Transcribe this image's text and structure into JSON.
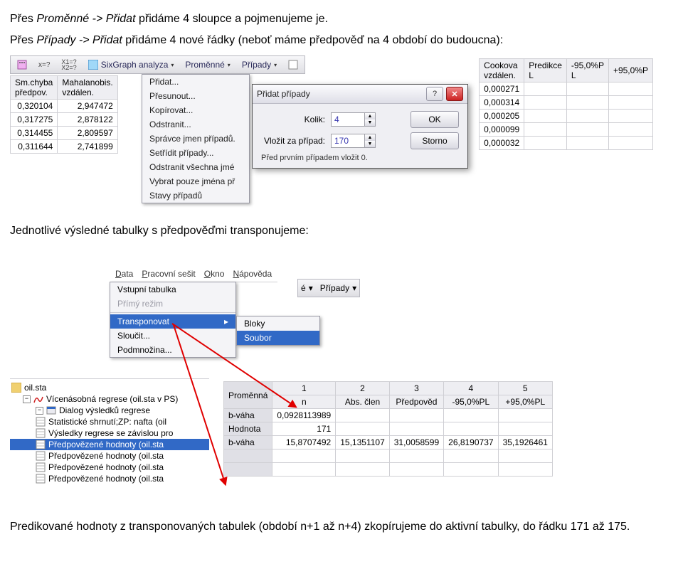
{
  "text": {
    "intro1_a": "Přes ",
    "intro1_em": "Proměnné -> Přidat",
    "intro1_b": " přidáme 4 sloupce a pojmenujeme je.",
    "intro2_a": "Přes ",
    "intro2_em": "Případy -> Přidat",
    "intro2_b": " přidáme 4 nové řádky (neboť máme předpověď na 4 období do budoucna):",
    "mid": "Jednotlivé výsledné tabulky s předpověďmi transponujeme:",
    "outro": "Predikované hodnoty z transponovaných tabulek (období n+1 až n+4) zkopírujeme do aktivní tabulky, do řádku 171 až 175."
  },
  "toolbar1": {
    "sixgraph": "SixGraph  analyza",
    "promenne": "Proměnné",
    "pripady": "Případy"
  },
  "ctx": {
    "items": [
      "Přidat...",
      "Přesunout...",
      "Kopírovat...",
      "Odstranit...",
      "Správce jmen případů.",
      "Setřídit případy...",
      "Odstranit všechna jmé",
      "Vybrat pouze jména př",
      "Stavy případů"
    ]
  },
  "dlg": {
    "title": "Přidat případy",
    "kolik": "Kolik:",
    "kolik_val": "4",
    "vlozit": "Vložit za případ:",
    "vlozit_val": "170",
    "ok": "OK",
    "storno": "Storno",
    "foot": "Před prvním případem vložit 0."
  },
  "lefttable": {
    "h1a": "Sm.chyba",
    "h1b": "předpov.",
    "h2a": "Mahalanobis.",
    "h2b": "vzdálen.",
    "rows": [
      [
        "0,320104",
        "2,947472"
      ],
      [
        "0,317275",
        "2,878122"
      ],
      [
        "0,314455",
        "2,809597"
      ],
      [
        "0,311644",
        "2,741899"
      ]
    ]
  },
  "righttable": {
    "h1a": "Cookova",
    "h1b": "vzdálen.",
    "h2a": "Predikce",
    "h2b": "L",
    "h3a": "-95,0%P",
    "h3b": "L",
    "h4a": "+95,0%P",
    "h4b": "",
    "rows": [
      [
        "0,000271",
        "",
        "",
        ""
      ],
      [
        "0,000314",
        "",
        "",
        ""
      ],
      [
        "0,000205",
        "",
        "",
        ""
      ],
      [
        "0,000099",
        "",
        "",
        ""
      ],
      [
        "0,000032",
        "",
        "",
        ""
      ]
    ]
  },
  "menubar": {
    "items": [
      "Data",
      "Pracovní sešit",
      "Okno",
      "Nápověda"
    ],
    "u": [
      "D",
      "P",
      "O",
      "N"
    ]
  },
  "datapanel": {
    "items": [
      "Vstupní tabulka",
      "Přímý režim",
      "Transponovat",
      "Sloučit...",
      "Podmnožina..."
    ],
    "selected_index": 2
  },
  "submenu": {
    "items": [
      "Bloky",
      "Soubor"
    ],
    "selected_index": 1
  },
  "toolbar2": {
    "suffix": "é",
    "pripady": "Případy"
  },
  "tree_header": "oil.sta",
  "tree": {
    "items": [
      {
        "icon": "curve",
        "label": "Vícenásobná regrese (oil.sta v PS)"
      },
      {
        "icon": "dialog",
        "label": "Dialog výsledků regrese"
      },
      {
        "icon": "sheet",
        "label": "Statistické shrnutí;ZP: nafta (oil"
      },
      {
        "icon": "sheet",
        "label": "Výsledky regrese se závislou pro"
      },
      {
        "icon": "sheet",
        "label": "Předpovězené hodnoty (oil.sta",
        "sel": true
      },
      {
        "icon": "sheet",
        "label": "Předpovězené hodnoty (oil.sta"
      },
      {
        "icon": "sheet",
        "label": "Předpovězené hodnoty (oil.sta"
      },
      {
        "icon": "sheet",
        "label": "Předpovězené hodnoty (oil.sta"
      }
    ]
  },
  "lower": {
    "hdr_prom": "Proměnná",
    "cols": [
      "1",
      "2",
      "3",
      "4",
      "5"
    ],
    "cols2": [
      "n",
      "Abs. člen",
      "Předpověd",
      "-95,0%PL",
      "+95,0%PL"
    ],
    "rows": [
      {
        "lbl": "b-váha",
        "v": [
          "0,0928113989",
          "",
          "",
          "",
          ""
        ]
      },
      {
        "lbl": "Hodnota",
        "v": [
          "171",
          "",
          "",
          "",
          ""
        ]
      },
      {
        "lbl": "b-váha",
        "v": [
          "15,8707492",
          "15,1351107",
          "31,0058599",
          "26,8190737",
          "35,1926461"
        ]
      }
    ]
  }
}
